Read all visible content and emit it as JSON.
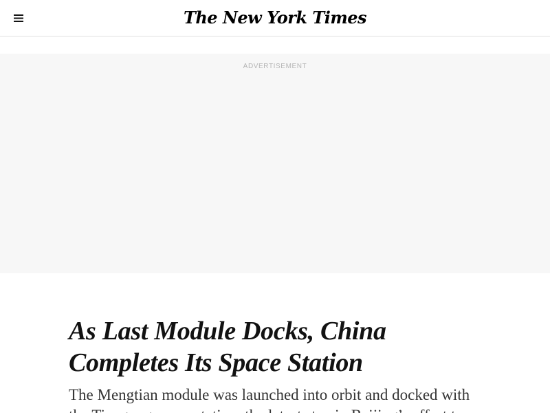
{
  "masthead": {
    "menu_icon": "hamburger-menu-icon",
    "logo_text": "The New York Times"
  },
  "ad": {
    "label": "ADVERTISEMENT"
  },
  "article": {
    "headline": "As Last Module Docks, China Completes Its Space Station",
    "summary": "The Mengtian module was launched into orbit and docked with the Tiangong space station, the latest step in Beijing’s effort to"
  },
  "colors": {
    "text": "#121212",
    "summary_text": "#363636",
    "ad_background": "#f7f7f7",
    "ad_label": "#b5b5b5",
    "divider": "#dfdfdf"
  }
}
